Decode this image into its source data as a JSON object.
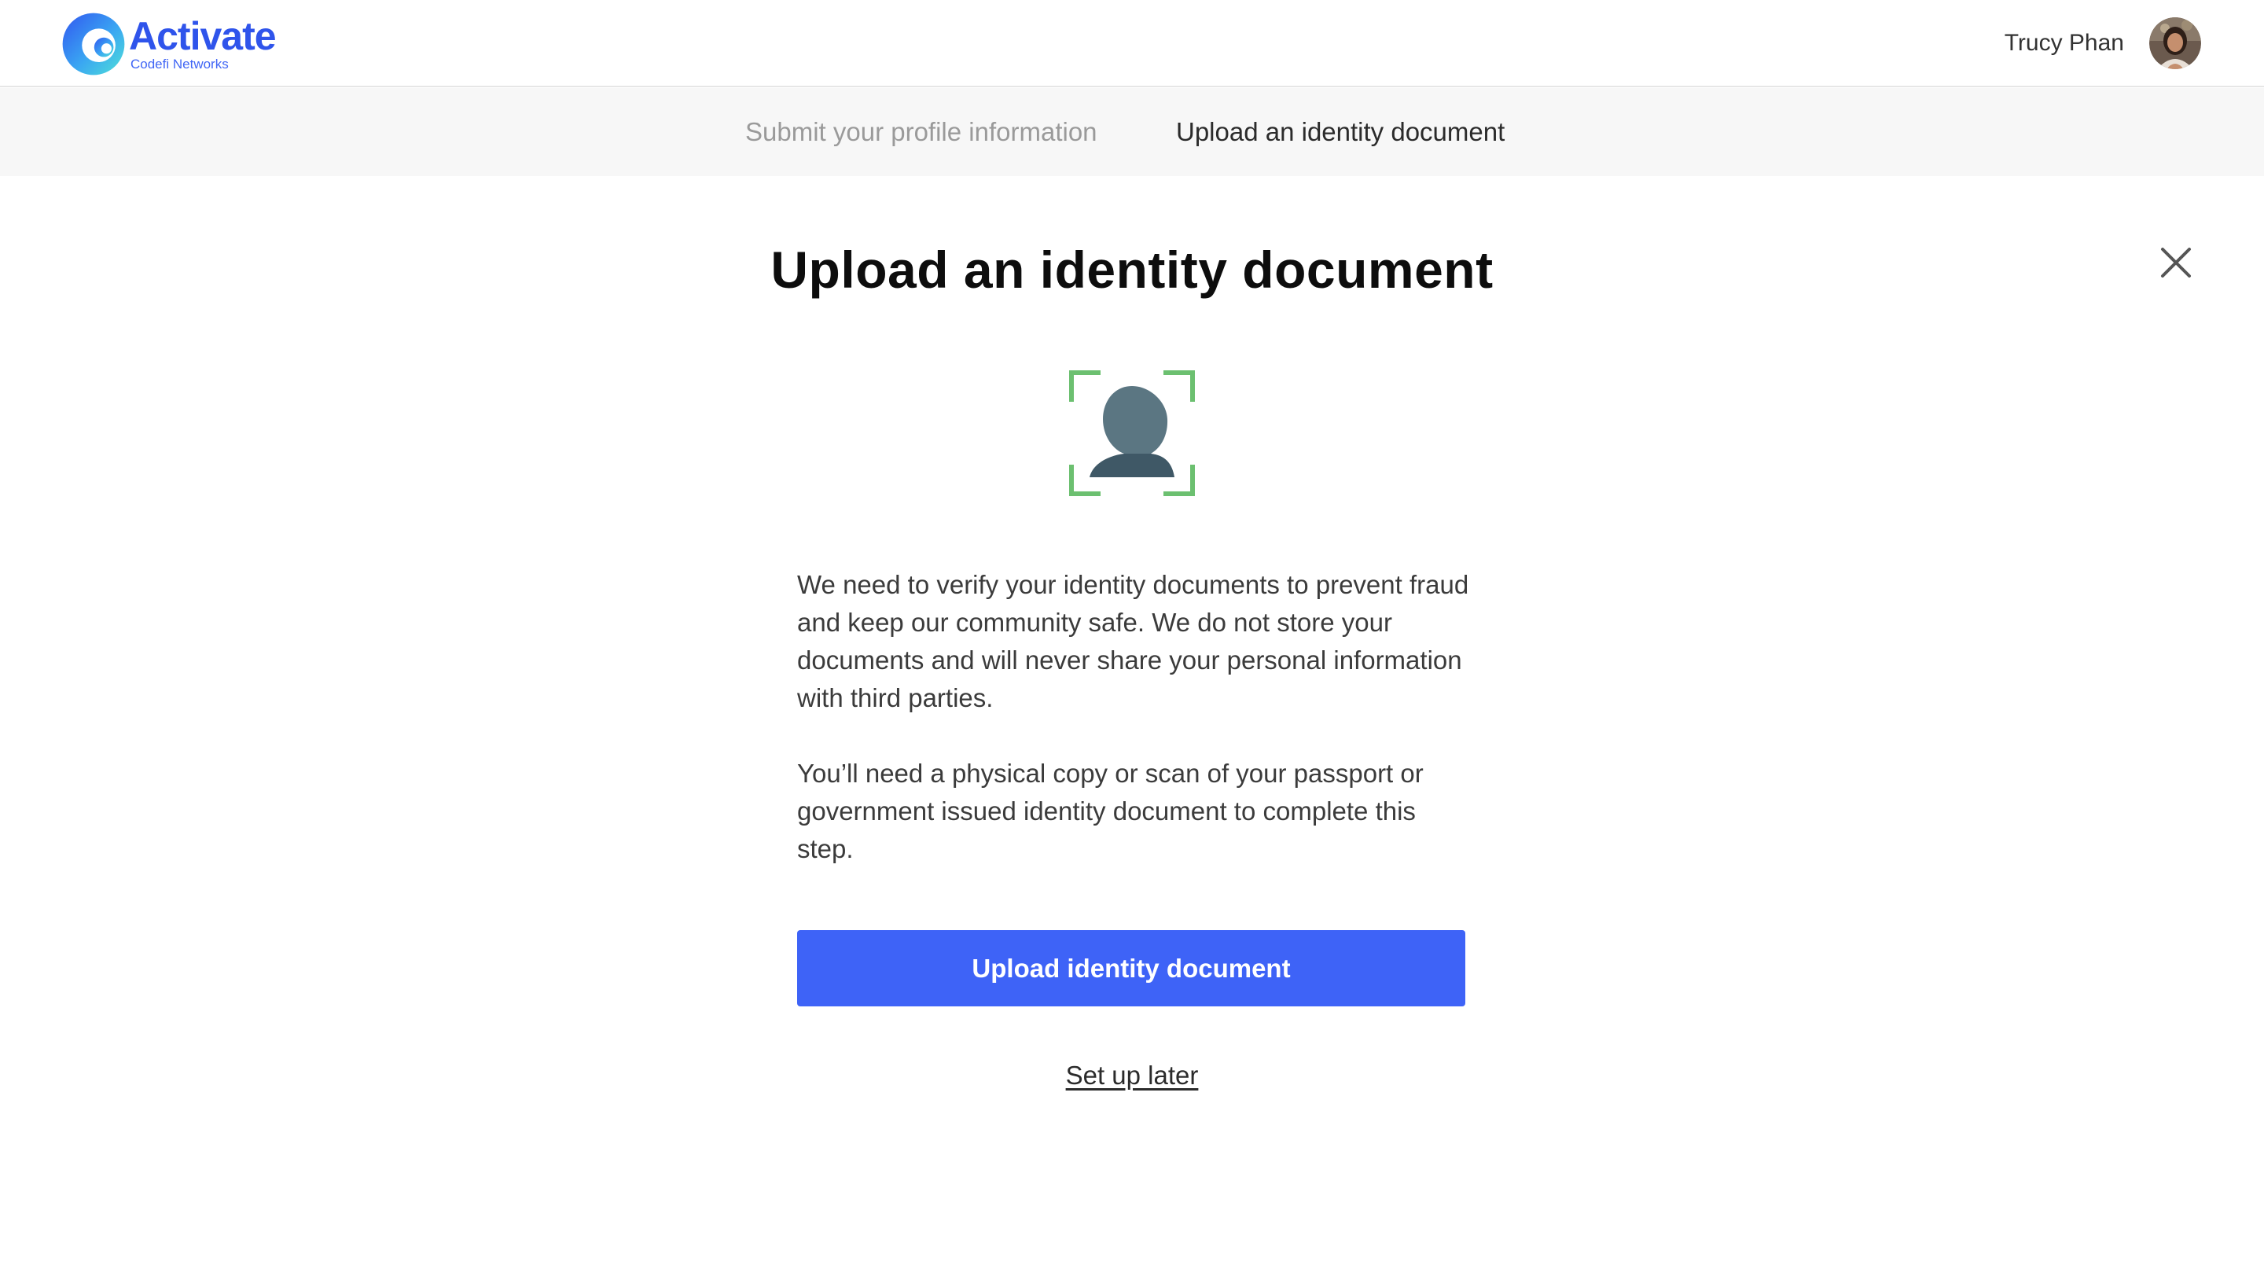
{
  "header": {
    "brand_name": "Activate",
    "brand_subtitle": "Codefi Networks",
    "brand_icon": "activate-logo-icon",
    "user_name": "Trucy Phan",
    "avatar_icon": "user-avatar"
  },
  "stepper": {
    "steps": [
      {
        "label": "Submit your profile information",
        "state": "inactive"
      },
      {
        "label": "Upload an identity document",
        "state": "active"
      }
    ]
  },
  "main": {
    "title": "Upload an identity document",
    "hero_icon": "face-scan-icon",
    "paragraphs": [
      "We need to verify your identity documents to prevent fraud and keep our community safe. We do not store your documents and will never share your personal information with third parties.",
      "You’ll need a physical copy or scan of your passport or government issued identity document to complete this step."
    ],
    "primary_button_label": "Upload identity document",
    "secondary_link_label": "Set up later",
    "close_icon": "close-icon"
  },
  "colors": {
    "brand": "#2f54eb",
    "primary_button": "#3e63f7",
    "scan_frame": "#6cc070",
    "silhouette": "#4a6a7a",
    "stepper_bg": "#f7f7f7"
  }
}
